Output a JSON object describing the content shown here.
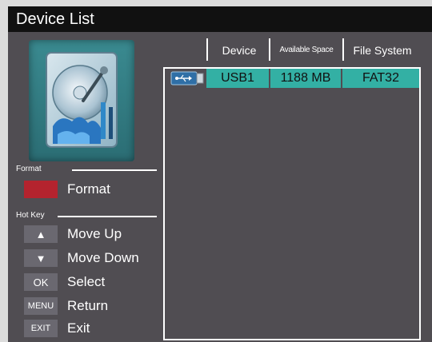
{
  "window": {
    "title": "Device List"
  },
  "sections": {
    "format_heading": "Format",
    "hotkey_heading": "Hot Key"
  },
  "format_legend": {
    "key": "",
    "label": "Format"
  },
  "hotkeys": [
    {
      "key": "▲",
      "label": "Move Up"
    },
    {
      "key": "▼",
      "label": "Move Down"
    },
    {
      "key": "OK",
      "label": "Select"
    },
    {
      "key": "MENU",
      "label": "Return"
    },
    {
      "key": "EXIT",
      "label": "Exit"
    }
  ],
  "table": {
    "columns": [
      "Device",
      "Available Space",
      "File System"
    ],
    "rows": [
      {
        "device": "USB1",
        "space": "1188 MB",
        "fs": "FAT32",
        "icon": "usb-drive-icon"
      }
    ]
  },
  "colors": {
    "background": "#504d52",
    "titlebar": "#111111",
    "selected_row": "#33b0a4",
    "format_key": "#b4232e",
    "hotkey_key": "#6a6870"
  }
}
